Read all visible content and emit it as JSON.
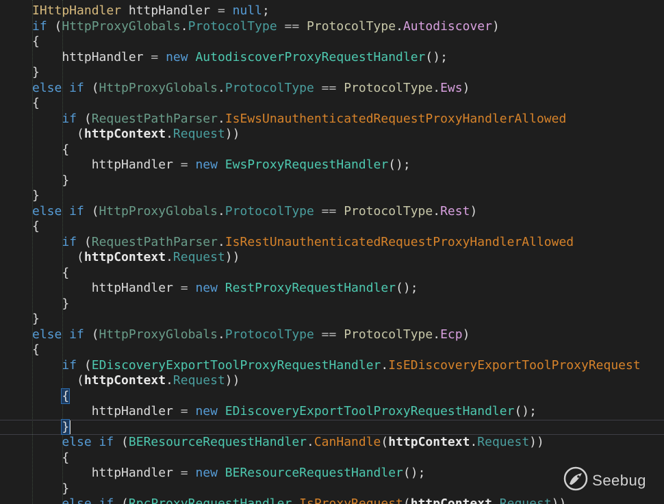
{
  "editor": {
    "lines": [
      [
        {
          "t": "IHttpHandler",
          "c": "t-gold"
        },
        {
          "t": " httpHandler ",
          "c": "t-ident"
        },
        {
          "t": "=",
          "c": "t-op"
        },
        {
          "t": " ",
          "c": "t-ident"
        },
        {
          "t": "null",
          "c": "t-kw"
        },
        {
          "t": ";",
          "c": "t-punct"
        }
      ],
      [
        {
          "t": "if",
          "c": "t-kw"
        },
        {
          "t": " (",
          "c": "t-punct"
        },
        {
          "t": "HttpProxyGlobals",
          "c": "t-typeDim"
        },
        {
          "t": ".",
          "c": "t-punct"
        },
        {
          "t": "ProtocolType",
          "c": "t-prop"
        },
        {
          "t": " == ",
          "c": "t-op"
        },
        {
          "t": "ProtocolType",
          "c": "t-cls"
        },
        {
          "t": ".",
          "c": "t-punct"
        },
        {
          "t": "Autodiscover",
          "c": "t-enum"
        },
        {
          "t": ")",
          "c": "t-punct"
        }
      ],
      [
        {
          "t": "{",
          "c": "t-punct"
        }
      ],
      [
        {
          "t": "    httpHandler ",
          "c": "t-ident"
        },
        {
          "t": "=",
          "c": "t-op"
        },
        {
          "t": " ",
          "c": "t-ident"
        },
        {
          "t": "new",
          "c": "t-kw"
        },
        {
          "t": " ",
          "c": "t-ident"
        },
        {
          "t": "AutodiscoverProxyRequestHandler",
          "c": "t-type"
        },
        {
          "t": "();",
          "c": "t-punct"
        }
      ],
      [
        {
          "t": "}",
          "c": "t-punct"
        }
      ],
      [
        {
          "t": "else if",
          "c": "t-kw"
        },
        {
          "t": " (",
          "c": "t-punct"
        },
        {
          "t": "HttpProxyGlobals",
          "c": "t-typeDim"
        },
        {
          "t": ".",
          "c": "t-punct"
        },
        {
          "t": "ProtocolType",
          "c": "t-prop"
        },
        {
          "t": " == ",
          "c": "t-op"
        },
        {
          "t": "ProtocolType",
          "c": "t-cls"
        },
        {
          "t": ".",
          "c": "t-punct"
        },
        {
          "t": "Ews",
          "c": "t-enum"
        },
        {
          "t": ")",
          "c": "t-punct"
        }
      ],
      [
        {
          "t": "{",
          "c": "t-punct"
        }
      ],
      [
        {
          "t": "    ",
          "c": "t-ident"
        },
        {
          "t": "if",
          "c": "t-kw"
        },
        {
          "t": " (",
          "c": "t-punct"
        },
        {
          "t": "RequestPathParser",
          "c": "t-typeDim"
        },
        {
          "t": ".",
          "c": "t-punct"
        },
        {
          "t": "IsEwsUnauthenticatedRequestProxyHandlerAllowed",
          "c": "t-method"
        }
      ],
      [
        {
          "t": "      (",
          "c": "t-punct"
        },
        {
          "t": "httpContext",
          "c": "t-bold"
        },
        {
          "t": ".",
          "c": "t-punct"
        },
        {
          "t": "Request",
          "c": "t-prop"
        },
        {
          "t": "))",
          "c": "t-punct"
        }
      ],
      [
        {
          "t": "    {",
          "c": "t-punct"
        }
      ],
      [
        {
          "t": "        httpHandler ",
          "c": "t-ident"
        },
        {
          "t": "=",
          "c": "t-op"
        },
        {
          "t": " ",
          "c": "t-ident"
        },
        {
          "t": "new",
          "c": "t-kw"
        },
        {
          "t": " ",
          "c": "t-ident"
        },
        {
          "t": "EwsProxyRequestHandler",
          "c": "t-type"
        },
        {
          "t": "();",
          "c": "t-punct"
        }
      ],
      [
        {
          "t": "    }",
          "c": "t-punct"
        }
      ],
      [
        {
          "t": "}",
          "c": "t-punct"
        }
      ],
      [
        {
          "t": "else if",
          "c": "t-kw"
        },
        {
          "t": " (",
          "c": "t-punct"
        },
        {
          "t": "HttpProxyGlobals",
          "c": "t-typeDim"
        },
        {
          "t": ".",
          "c": "t-punct"
        },
        {
          "t": "ProtocolType",
          "c": "t-prop"
        },
        {
          "t": " == ",
          "c": "t-op"
        },
        {
          "t": "ProtocolType",
          "c": "t-cls"
        },
        {
          "t": ".",
          "c": "t-punct"
        },
        {
          "t": "Rest",
          "c": "t-enum"
        },
        {
          "t": ")",
          "c": "t-punct"
        }
      ],
      [
        {
          "t": "{",
          "c": "t-punct"
        }
      ],
      [
        {
          "t": "    ",
          "c": "t-ident"
        },
        {
          "t": "if",
          "c": "t-kw"
        },
        {
          "t": " (",
          "c": "t-punct"
        },
        {
          "t": "RequestPathParser",
          "c": "t-typeDim"
        },
        {
          "t": ".",
          "c": "t-punct"
        },
        {
          "t": "IsRestUnauthenticatedRequestProxyHandlerAllowed",
          "c": "t-method"
        }
      ],
      [
        {
          "t": "      (",
          "c": "t-punct"
        },
        {
          "t": "httpContext",
          "c": "t-bold"
        },
        {
          "t": ".",
          "c": "t-punct"
        },
        {
          "t": "Request",
          "c": "t-prop"
        },
        {
          "t": "))",
          "c": "t-punct"
        }
      ],
      [
        {
          "t": "    {",
          "c": "t-punct"
        }
      ],
      [
        {
          "t": "        httpHandler ",
          "c": "t-ident"
        },
        {
          "t": "=",
          "c": "t-op"
        },
        {
          "t": " ",
          "c": "t-ident"
        },
        {
          "t": "new",
          "c": "t-kw"
        },
        {
          "t": " ",
          "c": "t-ident"
        },
        {
          "t": "RestProxyRequestHandler",
          "c": "t-type"
        },
        {
          "t": "();",
          "c": "t-punct"
        }
      ],
      [
        {
          "t": "    }",
          "c": "t-punct"
        }
      ],
      [
        {
          "t": "}",
          "c": "t-punct"
        }
      ],
      [
        {
          "t": "else if",
          "c": "t-kw"
        },
        {
          "t": " (",
          "c": "t-punct"
        },
        {
          "t": "HttpProxyGlobals",
          "c": "t-typeDim"
        },
        {
          "t": ".",
          "c": "t-punct"
        },
        {
          "t": "ProtocolType",
          "c": "t-prop"
        },
        {
          "t": " == ",
          "c": "t-op"
        },
        {
          "t": "ProtocolType",
          "c": "t-cls"
        },
        {
          "t": ".",
          "c": "t-punct"
        },
        {
          "t": "Ecp",
          "c": "t-enum"
        },
        {
          "t": ")",
          "c": "t-punct"
        }
      ],
      [
        {
          "t": "{",
          "c": "t-punct"
        }
      ],
      [
        {
          "t": "    ",
          "c": "t-ident"
        },
        {
          "t": "if",
          "c": "t-kw"
        },
        {
          "t": " (",
          "c": "t-punct"
        },
        {
          "t": "EDiscoveryExportToolProxyRequestHandler",
          "c": "t-type"
        },
        {
          "t": ".",
          "c": "t-punct"
        },
        {
          "t": "IsEDiscoveryExportToolProxyRequest",
          "c": "t-method"
        }
      ],
      [
        {
          "t": "      (",
          "c": "t-punct"
        },
        {
          "t": "httpContext",
          "c": "t-bold"
        },
        {
          "t": ".",
          "c": "t-punct"
        },
        {
          "t": "Request",
          "c": "t-prop"
        },
        {
          "t": "))",
          "c": "t-punct"
        }
      ],
      [
        {
          "t": "    ",
          "c": "t-ident"
        },
        {
          "t": "{",
          "c": "t-hlbrace"
        }
      ],
      [
        {
          "t": "        httpHandler ",
          "c": "t-ident"
        },
        {
          "t": "=",
          "c": "t-op"
        },
        {
          "t": " ",
          "c": "t-ident"
        },
        {
          "t": "new",
          "c": "t-kw"
        },
        {
          "t": " ",
          "c": "t-ident"
        },
        {
          "t": "EDiscoveryExportToolProxyRequestHandler",
          "c": "t-type"
        },
        {
          "t": "();",
          "c": "t-punct"
        }
      ],
      [
        {
          "t": "    ",
          "c": "t-ident"
        },
        {
          "t": "}",
          "c": "t-hlbrace"
        },
        {
          "t": "",
          "c": "caret"
        }
      ],
      [
        {
          "t": "    ",
          "c": "t-ident"
        },
        {
          "t": "else if",
          "c": "t-kw"
        },
        {
          "t": " (",
          "c": "t-punct"
        },
        {
          "t": "BEResourceRequestHandler",
          "c": "t-type"
        },
        {
          "t": ".",
          "c": "t-punct"
        },
        {
          "t": "CanHandle",
          "c": "t-method"
        },
        {
          "t": "(",
          "c": "t-punct"
        },
        {
          "t": "httpContext",
          "c": "t-bold"
        },
        {
          "t": ".",
          "c": "t-punct"
        },
        {
          "t": "Request",
          "c": "t-prop"
        },
        {
          "t": "))",
          "c": "t-punct"
        }
      ],
      [
        {
          "t": "    {",
          "c": "t-punct"
        }
      ],
      [
        {
          "t": "        httpHandler ",
          "c": "t-ident"
        },
        {
          "t": "=",
          "c": "t-op"
        },
        {
          "t": " ",
          "c": "t-ident"
        },
        {
          "t": "new",
          "c": "t-kw"
        },
        {
          "t": " ",
          "c": "t-ident"
        },
        {
          "t": "BEResourceRequestHandler",
          "c": "t-type"
        },
        {
          "t": "();",
          "c": "t-punct"
        }
      ],
      [
        {
          "t": "    }",
          "c": "t-punct"
        }
      ],
      [
        {
          "t": "    ",
          "c": "t-ident"
        },
        {
          "t": "else if",
          "c": "t-kw"
        },
        {
          "t": " (",
          "c": "t-punct"
        },
        {
          "t": "RpcProxyRequestHandler",
          "c": "t-type"
        },
        {
          "t": ".",
          "c": "t-punct"
        },
        {
          "t": "IsProxyRequest",
          "c": "t-method"
        },
        {
          "t": "(",
          "c": "t-punct"
        },
        {
          "t": "httpContext",
          "c": "t-bold"
        },
        {
          "t": ".",
          "c": "t-punct"
        },
        {
          "t": "Request",
          "c": "t-prop"
        },
        {
          "t": "))",
          "c": "t-punct"
        }
      ]
    ],
    "current_line": 27
  },
  "watermark": {
    "icon": "seebug-logo-icon",
    "text": "Seebug"
  }
}
